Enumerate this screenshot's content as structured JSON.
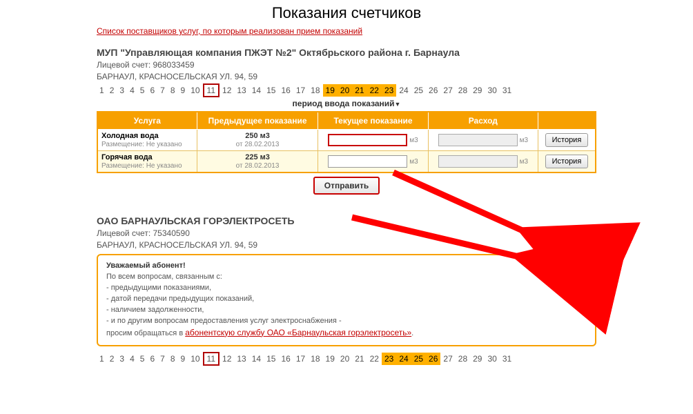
{
  "page_title": "Показания счетчиков",
  "providers_link": "Список поставщиков услуг, по которым реализован прием показаний",
  "block1": {
    "company": "МУП \"Управляющая компания ПЖЭТ №2\" Октябрьского района г. Барнаула",
    "account_label": "Лицевой счет: 968033459",
    "address": "БАРНАУЛ, КРАСНОСЕЛЬСКАЯ УЛ. 94, 59",
    "days": [
      "1",
      "2",
      "3",
      "4",
      "5",
      "6",
      "7",
      "8",
      "9",
      "10",
      "11",
      "12",
      "13",
      "14",
      "15",
      "16",
      "17",
      "18",
      "19",
      "20",
      "21",
      "22",
      "23",
      "24",
      "25",
      "26",
      "27",
      "28",
      "29",
      "30",
      "31"
    ],
    "current_day": "11",
    "highlight_range": [
      "19",
      "20",
      "21",
      "22",
      "23"
    ],
    "period_label": "период ввода показаний",
    "columns": {
      "service": "Услуга",
      "prev": "Предыдущее показание",
      "curr": "Текущее показание",
      "spent": "Расход"
    },
    "rows": [
      {
        "service": "Холодная вода",
        "placement": "Размещение: Не указано",
        "prev_val": "250 м3",
        "prev_date": "от 28.02.2013",
        "unit": "м3",
        "history": "История"
      },
      {
        "service": "Горячая вода",
        "placement": "Размещение: Не указано",
        "prev_val": "225 м3",
        "prev_date": "от 28.02.2013",
        "unit": "м3",
        "history": "История"
      }
    ],
    "send_label": "Отправить"
  },
  "block2": {
    "company": "ОАО БАРНАУЛЬСКАЯ ГОРЭЛЕКТРОСЕТЬ",
    "account_label": "Лицевой счет: 75340590",
    "address": "БАРНАУЛ, КРАСНОСЕЛЬСКАЯ УЛ. 94, 59",
    "notice_title": "Уважаемый абонент!",
    "notice_lines": [
      "По всем вопросам, связанным с:",
      "- предыдущими показаниями,",
      "- датой передачи предыдущих показаний,",
      "- наличием задолженности,",
      "- и по другим вопросам предоставления услуг электроснабжения -",
      "просим обращаться в "
    ],
    "notice_link": "абонентскую службу ОАО «Барнаульская горэлектросеть»",
    "notice_tail": ".",
    "days": [
      "1",
      "2",
      "3",
      "4",
      "5",
      "6",
      "7",
      "8",
      "9",
      "10",
      "11",
      "12",
      "13",
      "14",
      "15",
      "16",
      "17",
      "18",
      "19",
      "20",
      "21",
      "22",
      "23",
      "24",
      "25",
      "26",
      "27",
      "28",
      "29",
      "30",
      "31"
    ],
    "current_day": "11",
    "highlight_range": [
      "23",
      "24",
      "25",
      "26"
    ]
  }
}
